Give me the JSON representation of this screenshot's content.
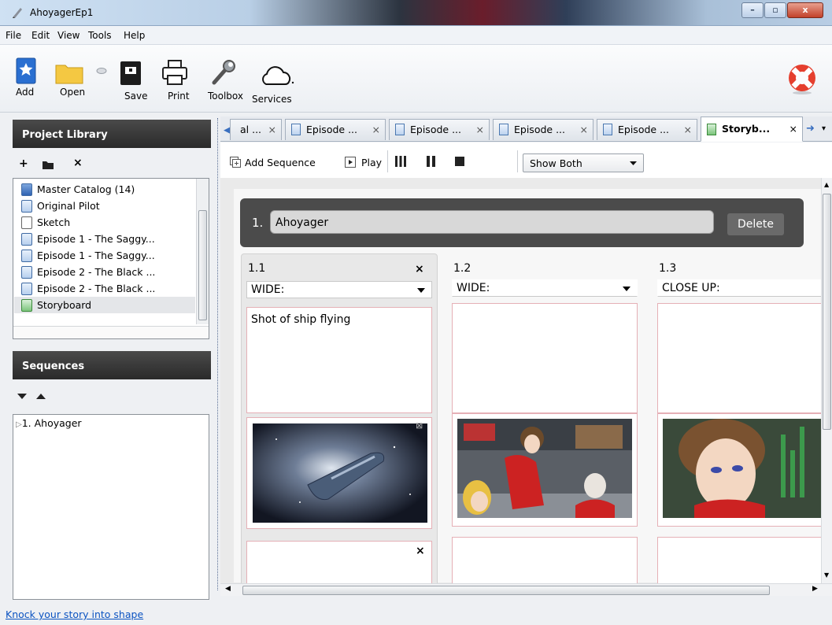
{
  "window": {
    "title": "AhoyagerEp1",
    "min": "–",
    "max": "▫",
    "close": "x"
  },
  "menu": [
    {
      "label": "File"
    },
    {
      "label": "Edit"
    },
    {
      "label": "View"
    },
    {
      "label": "Tools"
    },
    {
      "label": "Help"
    }
  ],
  "toolbar": {
    "add": "Add",
    "open": "Open",
    "save": "Save",
    "print": "Print",
    "toolbox": "Toolbox",
    "services": "Services"
  },
  "project_library": {
    "title": "Project Library",
    "items": [
      {
        "label": "Master Catalog (14)",
        "icon": "catalog-icon"
      },
      {
        "label": "Original Pilot",
        "icon": "document-icon"
      },
      {
        "label": "Sketch",
        "icon": "sketch-icon"
      },
      {
        "label": "Episode 1 - The Saggy...",
        "icon": "document-icon"
      },
      {
        "label": "Episode 1 - The Saggy...",
        "icon": "document-icon"
      },
      {
        "label": "Episode 2 - The Black ...",
        "icon": "document-icon"
      },
      {
        "label": "Episode 2 - The Black ...",
        "icon": "document-icon"
      },
      {
        "label": "Storyboard",
        "icon": "storyboard-icon"
      }
    ]
  },
  "sequences": {
    "title": "Sequences",
    "items": [
      {
        "label": "1. Ahoyager"
      }
    ]
  },
  "tabs": [
    {
      "label": "al ..."
    },
    {
      "label": "Episode ..."
    },
    {
      "label": "Episode ..."
    },
    {
      "label": "Episode ..."
    },
    {
      "label": "Episode ..."
    },
    {
      "label": "Storyb..."
    }
  ],
  "story_toolbar": {
    "add_sequence": "Add Sequence",
    "play": "Play",
    "view_select": "Show Both"
  },
  "sequence": {
    "number": "1.",
    "name": "Ahoyager",
    "delete": "Delete"
  },
  "shots": [
    {
      "number": "1.1",
      "type": "WIDE:",
      "description": "Shot of ship flying"
    },
    {
      "number": "1.2",
      "type": "WIDE:",
      "description": ""
    },
    {
      "number": "1.3",
      "type": "CLOSE UP:",
      "description": ""
    }
  ],
  "status": {
    "link": "Knock your story into shape"
  },
  "colors": {
    "header_dark": "#333333",
    "accent_link": "#0b53c1",
    "card_border": "#e5b0b6"
  }
}
